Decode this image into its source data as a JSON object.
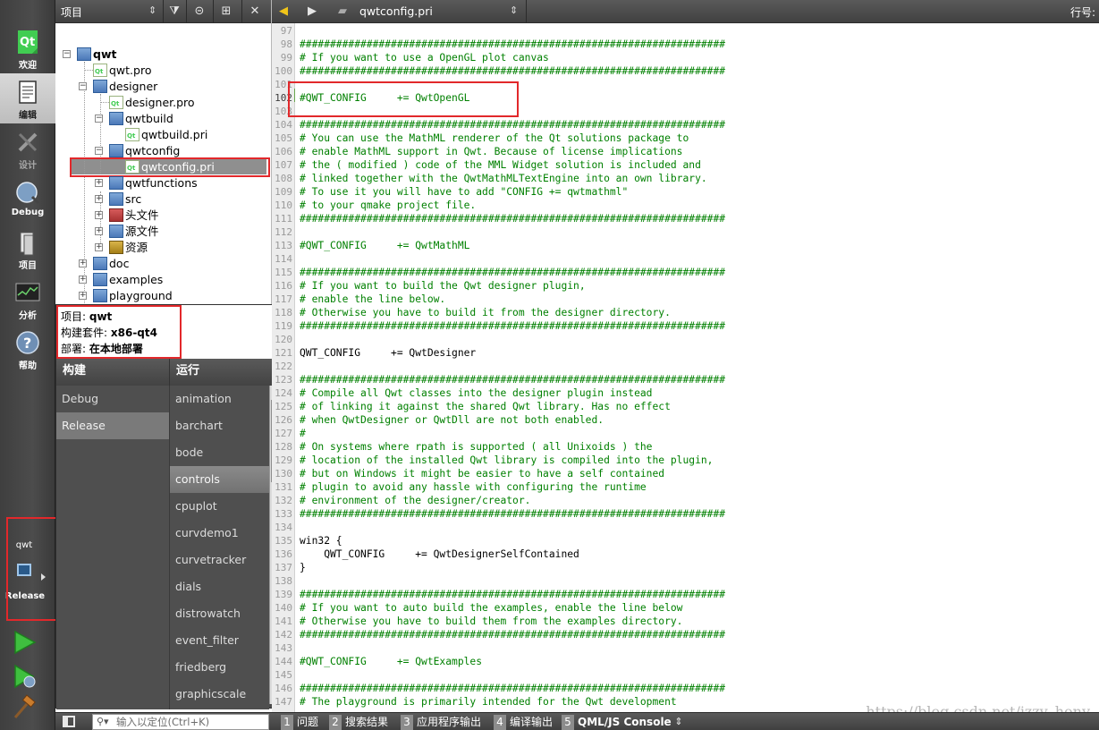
{
  "modes": [
    {
      "label": "欢迎",
      "icon": "qt-logo-icon"
    },
    {
      "label": "编辑",
      "icon": "edit-document-icon"
    },
    {
      "label": "设计",
      "icon": "design-tools-icon"
    },
    {
      "label": "Debug",
      "icon": "debug-bug-icon"
    },
    {
      "label": "项目",
      "icon": "project-wrench-icon"
    },
    {
      "label": "分析",
      "icon": "analyze-monitor-icon"
    },
    {
      "label": "帮助",
      "icon": "help-question-icon"
    }
  ],
  "target_selector": {
    "project": "qwt",
    "config": "Release"
  },
  "project_panel": {
    "title": "项目",
    "tree": [
      {
        "label": "qwt",
        "bold": true
      },
      {
        "label": "qwt.pro"
      },
      {
        "label": "designer"
      },
      {
        "label": "designer.pro"
      },
      {
        "label": "qwtbuild"
      },
      {
        "label": "qwtbuild.pri"
      },
      {
        "label": "qwtconfig"
      },
      {
        "label": "qwtconfig.pri",
        "selected": true
      },
      {
        "label": "qwtfunctions"
      },
      {
        "label": "src"
      },
      {
        "label": "头文件"
      },
      {
        "label": "源文件"
      },
      {
        "label": "资源"
      },
      {
        "label": "doc"
      },
      {
        "label": "examples"
      },
      {
        "label": "playground"
      },
      {
        "label": "qwtconfig"
      }
    ]
  },
  "popup": {
    "project_label": "项目:",
    "project_value": "qwt",
    "kit_label": "构建套件:",
    "kit_value": "x86-qt4",
    "deploy_label": "部署:",
    "deploy_value": "在本地部署",
    "build_header": "构建",
    "run_header": "运行",
    "build_items": [
      "Debug",
      "Release"
    ],
    "build_selected": "Release",
    "run_items": [
      "animation",
      "barchart",
      "bode",
      "controls",
      "cpuplot",
      "curvdemo1",
      "curvetracker",
      "dials",
      "distrowatch",
      "event_filter",
      "friedberg",
      "graphicscale"
    ],
    "run_selected": "controls"
  },
  "editor": {
    "filename": "qwtconfig.pri",
    "position_label": "行号:",
    "first_line": 97,
    "current_line": 102,
    "lines": [
      "",
      "######################################################################",
      "# If you want to use a OpenGL plot canvas",
      "######################################################################",
      "",
      "#QWT_CONFIG     += QwtOpenGL",
      "",
      "######################################################################",
      "# You can use the MathML renderer of the Qt solutions package to",
      "# enable MathML support in Qwt. Because of license implications",
      "# the ( modified ) code of the MML Widget solution is included and",
      "# linked together with the QwtMathMLTextEngine into an own library.",
      "# To use it you will have to add \"CONFIG += qwtmathml\"",
      "# to your qmake project file.",
      "######################################################################",
      "",
      "#QWT_CONFIG     += QwtMathML",
      "",
      "######################################################################",
      "# If you want to build the Qwt designer plugin,",
      "# enable the line below.",
      "# Otherwise you have to build it from the designer directory.",
      "######################################################################",
      "",
      "QWT_CONFIG     += QwtDesigner",
      "",
      "######################################################################",
      "# Compile all Qwt classes into the designer plugin instead",
      "# of linking it against the shared Qwt library. Has no effect",
      "# when QwtDesigner or QwtDll are not both enabled.",
      "#",
      "# On systems where rpath is supported ( all Unixoids ) the",
      "# location of the installed Qwt library is compiled into the plugin,",
      "# but on Windows it might be easier to have a self contained",
      "# plugin to avoid any hassle with configuring the runtime",
      "# environment of the designer/creator.",
      "######################################################################",
      "",
      "win32 {",
      "    QWT_CONFIG     += QwtDesignerSelfContained",
      "}",
      "",
      "######################################################################",
      "# If you want to auto build the examples, enable the line below",
      "# Otherwise you have to build them from the examples directory.",
      "######################################################################",
      "",
      "#QWT_CONFIG     += QwtExamples",
      "",
      "######################################################################",
      "# The playground is primarily intended for the Qwt development"
    ]
  },
  "locator": {
    "placeholder": "输入以定位(Ctrl+K)"
  },
  "output_tabs": [
    {
      "num": "1",
      "label": "问题"
    },
    {
      "num": "2",
      "label": "搜索结果"
    },
    {
      "num": "3",
      "label": "应用程序输出"
    },
    {
      "num": "4",
      "label": "编译输出"
    },
    {
      "num": "5",
      "label": "QML/JS Console"
    }
  ],
  "watermark": "https://blog.csdn.net/jzzy_hony",
  "colors": {
    "highlight_red": "#e2282b",
    "comment_green": "#008000",
    "qt_green": "#41cd52"
  }
}
